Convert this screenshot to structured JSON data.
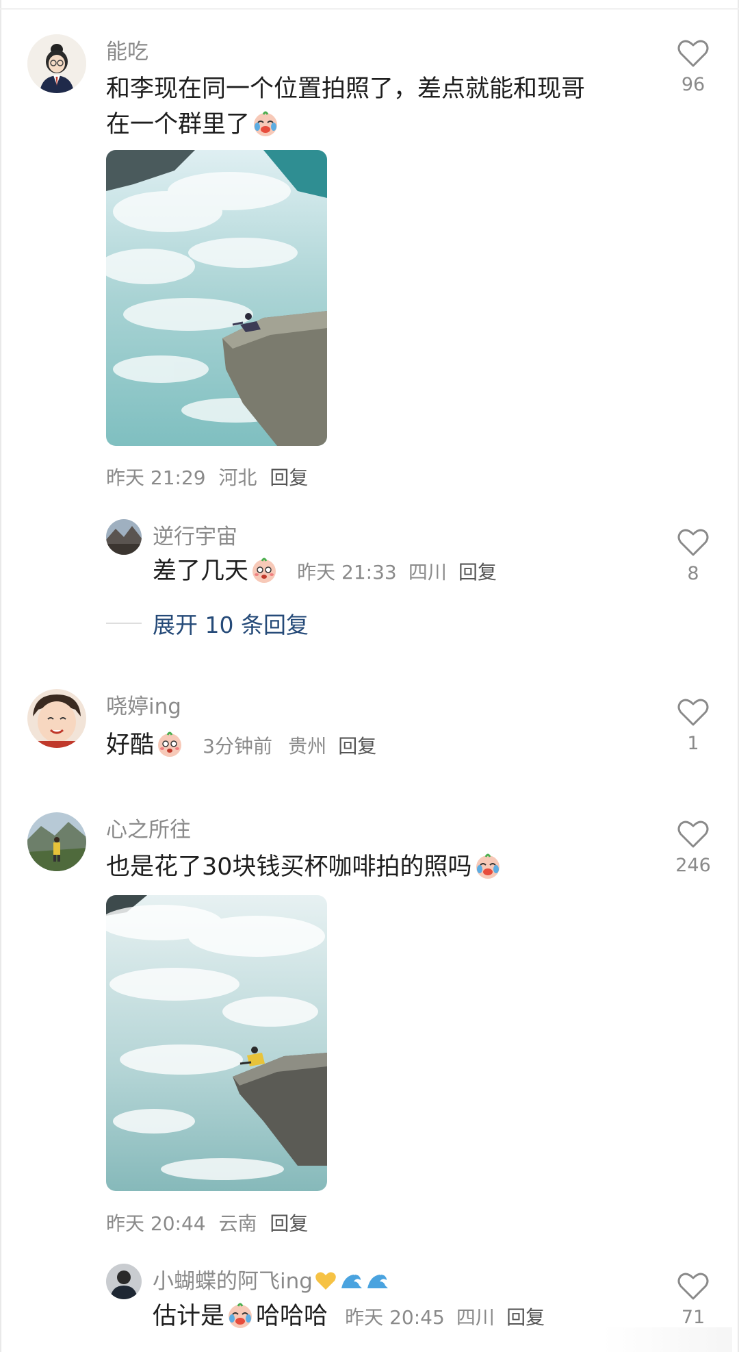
{
  "comments": [
    {
      "username": "能吃",
      "text_line1": "和李现在同一个位置拍照了，差点就能和现哥",
      "text_line2": "在一个群里了",
      "time": "昨天 21:29",
      "location": "河北",
      "reply_label": "回复",
      "likes": "96",
      "replies": [
        {
          "username": "逆行宇宙",
          "text": "差了几天",
          "time": "昨天 21:33",
          "location": "四川",
          "reply_label": "回复",
          "likes": "8"
        }
      ],
      "expand_label": "展开 10 条回复"
    },
    {
      "username": "哓婷ing",
      "text": "好酷",
      "time": "3分钟前",
      "location": "贵州",
      "reply_label": "回复",
      "likes": "1"
    },
    {
      "username": "心之所往",
      "text": "也是花了30块钱买杯咖啡拍的照吗",
      "time": "昨天 20:44",
      "location": "云南",
      "reply_label": "回复",
      "likes": "246",
      "replies": [
        {
          "username": "小蝴蝶的阿飞ing",
          "text_before": "估计是",
          "text_after": "哈哈哈",
          "time": "昨天 20:45",
          "location": "四川",
          "reply_label": "回复",
          "likes": "71"
        }
      ]
    }
  ],
  "colors": {
    "link": "#254a78",
    "meta": "#8a8a8a",
    "text": "#1e1e1e",
    "background": "#ffffff"
  },
  "icons": [
    "heart-outline-icon",
    "crying-laughing-emoji",
    "sad-face-emoji",
    "yellow-heart-emoji",
    "wave-emoji"
  ]
}
